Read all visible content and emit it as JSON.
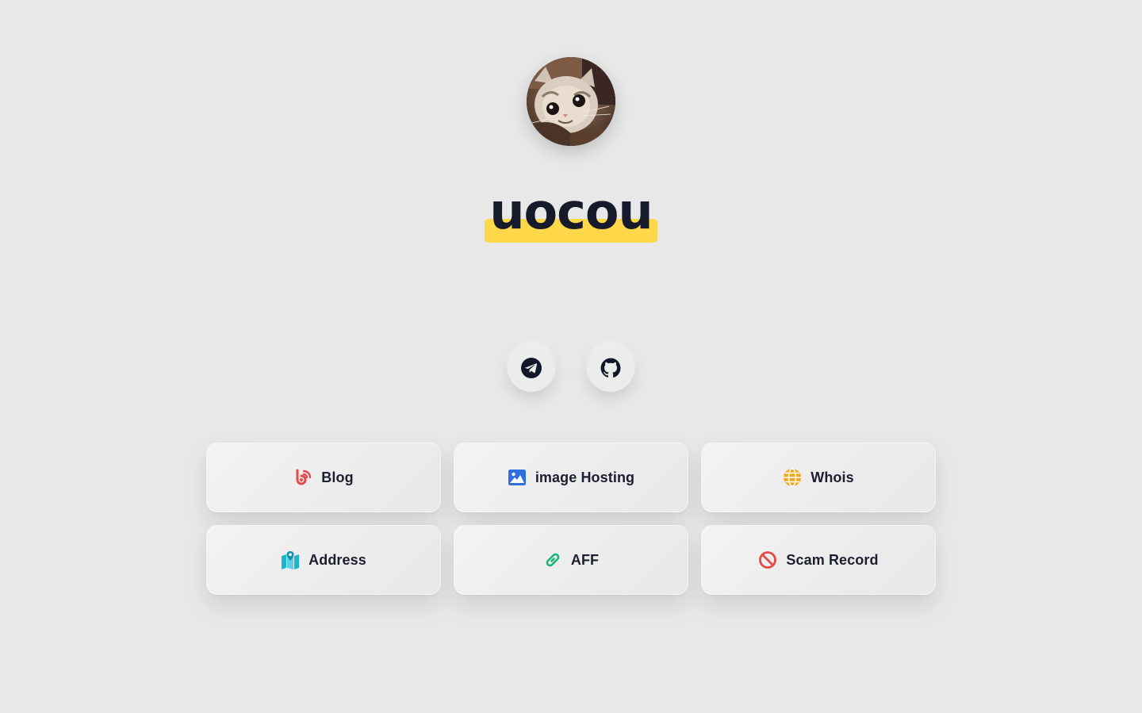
{
  "profile": {
    "name": "uocou",
    "avatar_icon": "cat-photo-avatar",
    "highlight_color": "#ffd84a"
  },
  "social": [
    {
      "name": "Telegram",
      "icon": "telegram-icon"
    },
    {
      "name": "GitHub",
      "icon": "github-icon"
    }
  ],
  "links": [
    {
      "label": "Blog",
      "icon": "blog-icon",
      "color": "#e84a4a"
    },
    {
      "label": "image Hosting",
      "icon": "image-icon",
      "color": "#2f6fe0"
    },
    {
      "label": "Whois",
      "icon": "globe-icon",
      "color": "#f2a81d"
    },
    {
      "label": "Address",
      "icon": "map-icon",
      "color": "#19b6cf"
    },
    {
      "label": "AFF",
      "icon": "link-icon",
      "color": "#1bb57a"
    },
    {
      "label": "Scam Record",
      "icon": "ban-icon",
      "color": "#e84a4a"
    }
  ]
}
